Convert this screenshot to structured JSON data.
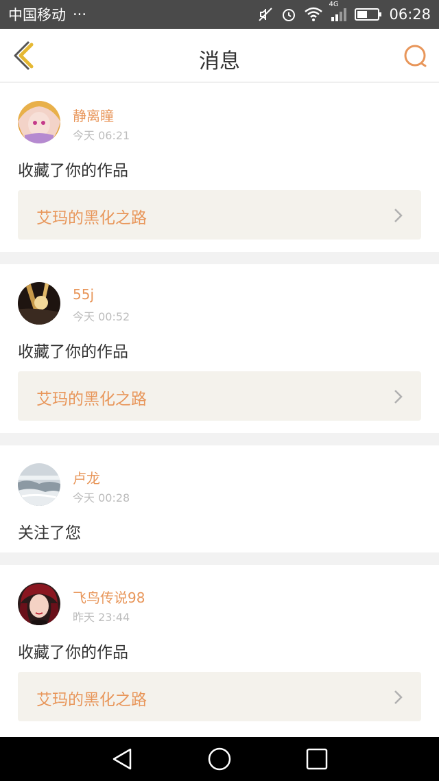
{
  "status_bar": {
    "carrier": "中国移动",
    "more": "···",
    "network": "4G",
    "time": "06:28",
    "icons": [
      "mute-icon",
      "alarm-icon",
      "wifi-icon",
      "signal-icon",
      "battery-icon"
    ]
  },
  "header": {
    "title": "消息",
    "back_icon": "chevron-left-icon",
    "search_icon": "search-icon",
    "accent_color": "#e8965a"
  },
  "messages": [
    {
      "user": "静离瞳",
      "time": "今天 06:21",
      "action": "收藏了你的作品",
      "work": "艾玛的黑化之路"
    },
    {
      "user": "55j",
      "time": "今天 00:52",
      "action": "收藏了你的作品",
      "work": "艾玛的黑化之路"
    },
    {
      "user": "卢龙",
      "time": "今天 00:28",
      "action": "关注了您"
    },
    {
      "user": "飞鸟传说98",
      "time": "昨天 23:44",
      "action": "收藏了你的作品",
      "work": "艾玛的黑化之路"
    }
  ],
  "system_nav": [
    "back-triangle-icon",
    "home-circle-icon",
    "recents-square-icon"
  ]
}
